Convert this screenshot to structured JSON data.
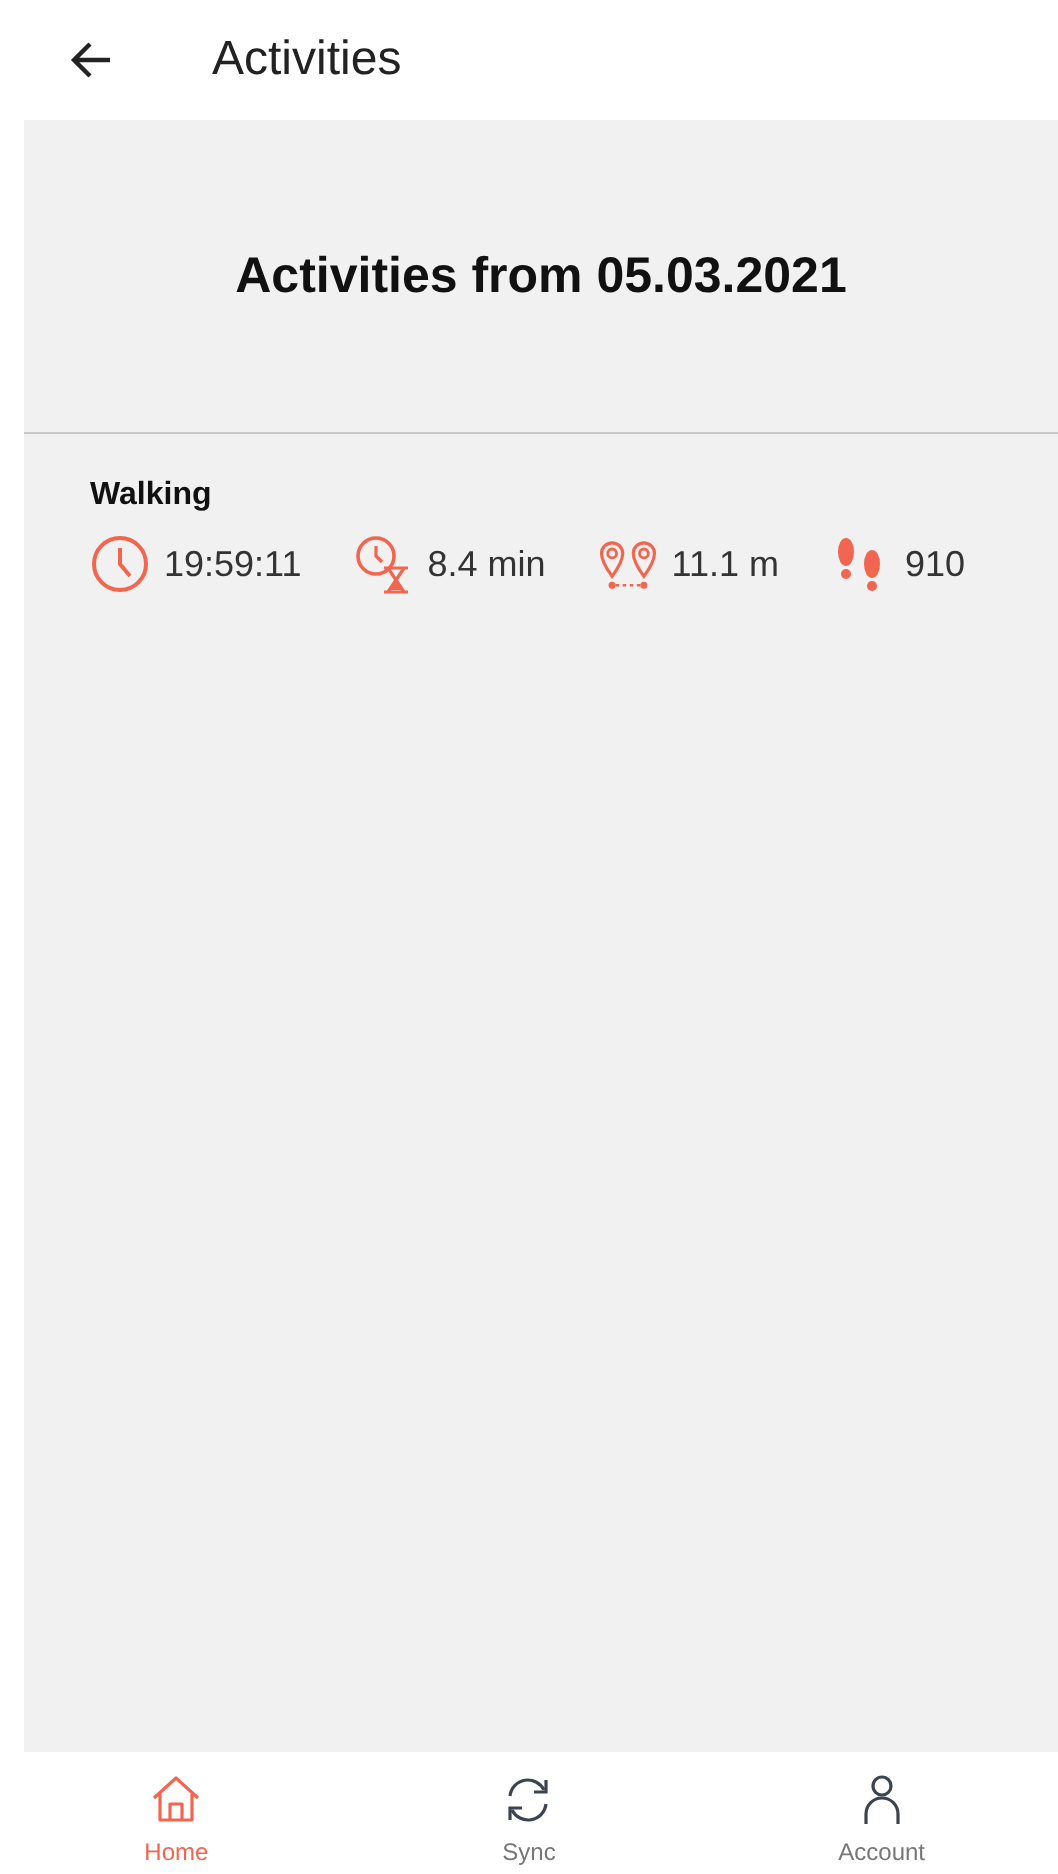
{
  "app_bar": {
    "title": "Activities"
  },
  "heading": "Activities from 05.03.2021",
  "activities": [
    {
      "name": "Walking",
      "stats": [
        {
          "kind": "time",
          "text": "19:59:11"
        },
        {
          "kind": "duration",
          "text": "8.4 min"
        },
        {
          "kind": "distance",
          "text": "11.1 m"
        },
        {
          "kind": "steps",
          "text": "910"
        }
      ]
    }
  ],
  "nav": [
    {
      "kind": "home",
      "label": "Home",
      "selected": true
    },
    {
      "kind": "sync",
      "label": "Sync",
      "selected": false
    },
    {
      "kind": "account",
      "label": "Account",
      "selected": false
    }
  ]
}
